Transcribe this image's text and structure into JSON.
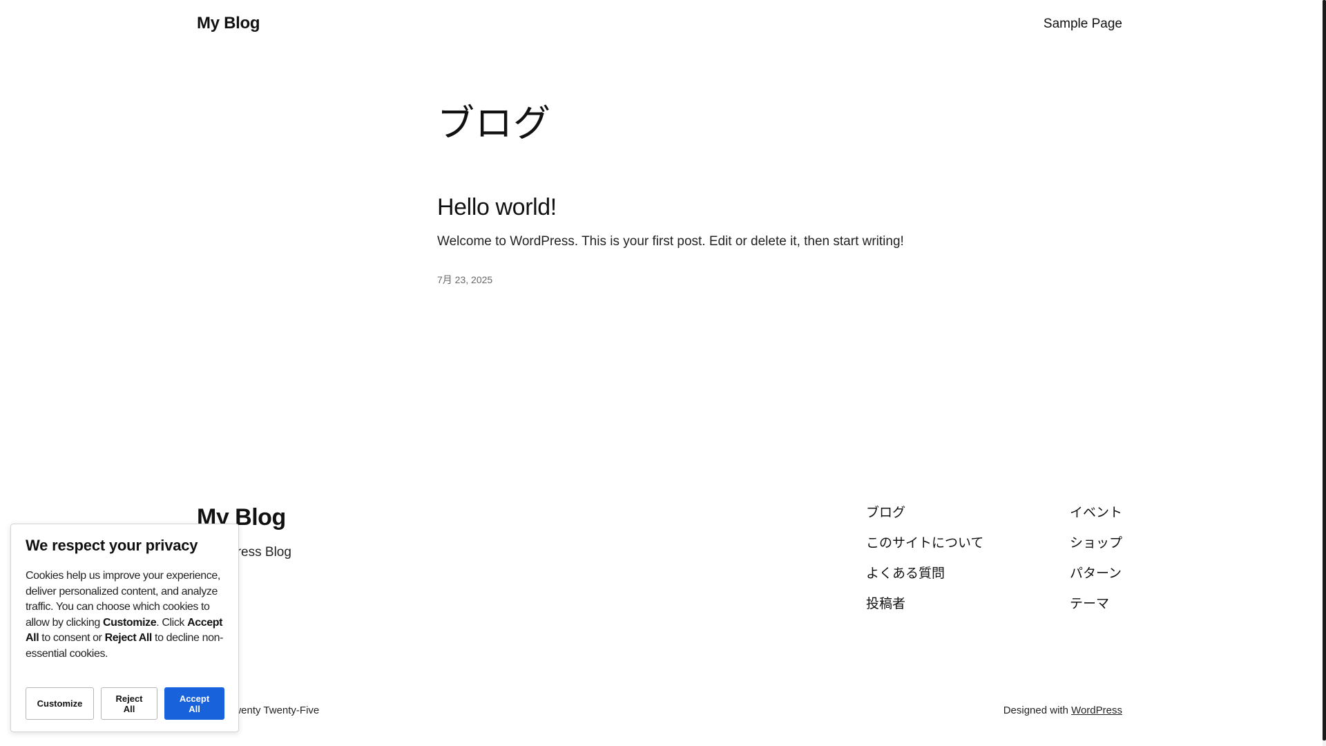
{
  "header": {
    "site_title": "My Blog",
    "nav_item": "Sample Page"
  },
  "main": {
    "archive_title": "ブログ",
    "post": {
      "title": "Hello world!",
      "excerpt": "Welcome to WordPress. This is your first post. Edit or delete it, then start writing!",
      "date": "7月 23, 2025"
    }
  },
  "footer": {
    "site_title": "My Blog",
    "tagline": "WordPress Blog",
    "nav_col1": [
      "ブログ",
      "このサイトについて",
      "よくある質問",
      "投稿者"
    ],
    "nav_col2": [
      "イベント",
      "ショップ",
      "パターン",
      "テーマ"
    ],
    "credit_left": "Twenty Twenty-Five",
    "credit_right_prefix": "Designed with",
    "credit_right_link": "WordPress"
  },
  "cookie_banner": {
    "title": "We respect your privacy",
    "text_part1": "Cookies help us improve your experience, deliver personalized content, and analyze traffic. You can choose which cookies to allow by clicking ",
    "text_bold1": "Customize",
    "text_part2": ". Click ",
    "text_bold2": "Accept All",
    "text_part3": " to consent or ",
    "text_bold3": "Reject All",
    "text_part4": " to decline non-essential cookies.",
    "customize_label": "Customize",
    "reject_label": "Reject All",
    "accept_label": "Accept All",
    "accent_color": "#1863dc"
  }
}
